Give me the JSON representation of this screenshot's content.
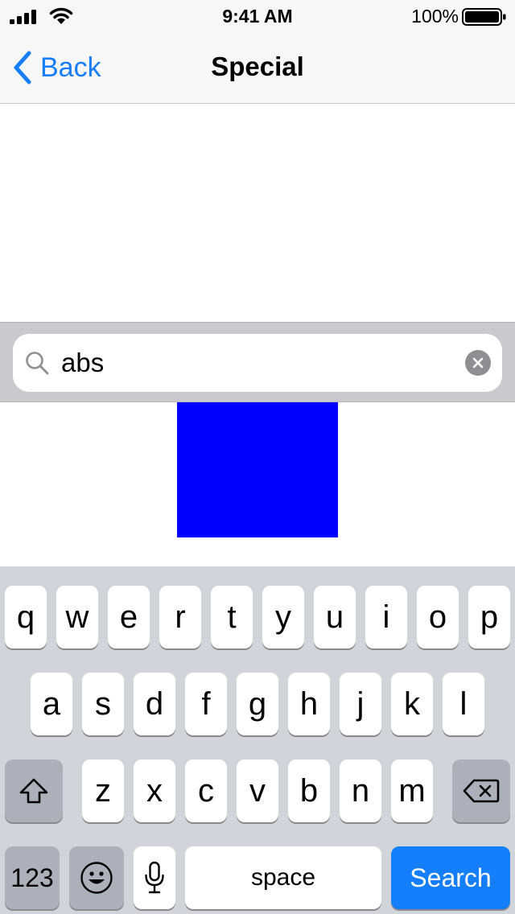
{
  "status_bar": {
    "time": "9:41 AM",
    "battery": "100%"
  },
  "nav": {
    "back_label": "Back",
    "title": "Special"
  },
  "search": {
    "value": "abs"
  },
  "colors": {
    "accent": "#147efb",
    "square": "#0000ff",
    "keyboard_bg": "#d1d4da",
    "search_bg": "#c9c9ce"
  },
  "keyboard": {
    "row1": [
      "q",
      "w",
      "e",
      "r",
      "t",
      "y",
      "u",
      "i",
      "o",
      "p"
    ],
    "row2": [
      "a",
      "s",
      "d",
      "f",
      "g",
      "h",
      "j",
      "k",
      "l"
    ],
    "row3": [
      "z",
      "x",
      "c",
      "v",
      "b",
      "n",
      "m"
    ],
    "numbers_label": "123",
    "space_label": "space",
    "search_label": "Search",
    "icons": {
      "shift": "shift-icon",
      "delete": "delete-icon",
      "emoji": "emoji-icon",
      "mic": "microphone-icon"
    }
  }
}
